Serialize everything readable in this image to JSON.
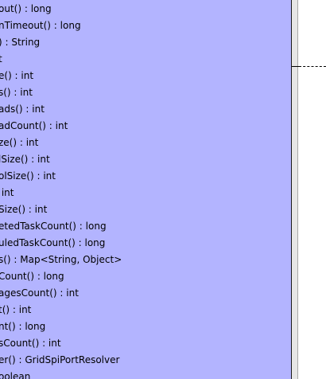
{
  "class_box": {
    "background_color": "#b3b4ff",
    "methods": [
      "out() : long",
      "nTimeout() : long",
      ") : String",
      "t",
      "e() : int",
      "s() : int",
      "ads() : int",
      "adCount() : int",
      "ze() : int",
      "lSize() : int",
      "olSize() : int",
      " int",
      "Size() : int",
      "etedTaskCount() : long",
      "uledTaskCount() : long",
      "s() : Map<String, Object>",
      "Count() : long",
      "agesCount() : int",
      "t() : int",
      "nt() : long",
      "sCount() : int",
      "er() : GridSpiPortResolver",
      "oolean"
    ]
  }
}
